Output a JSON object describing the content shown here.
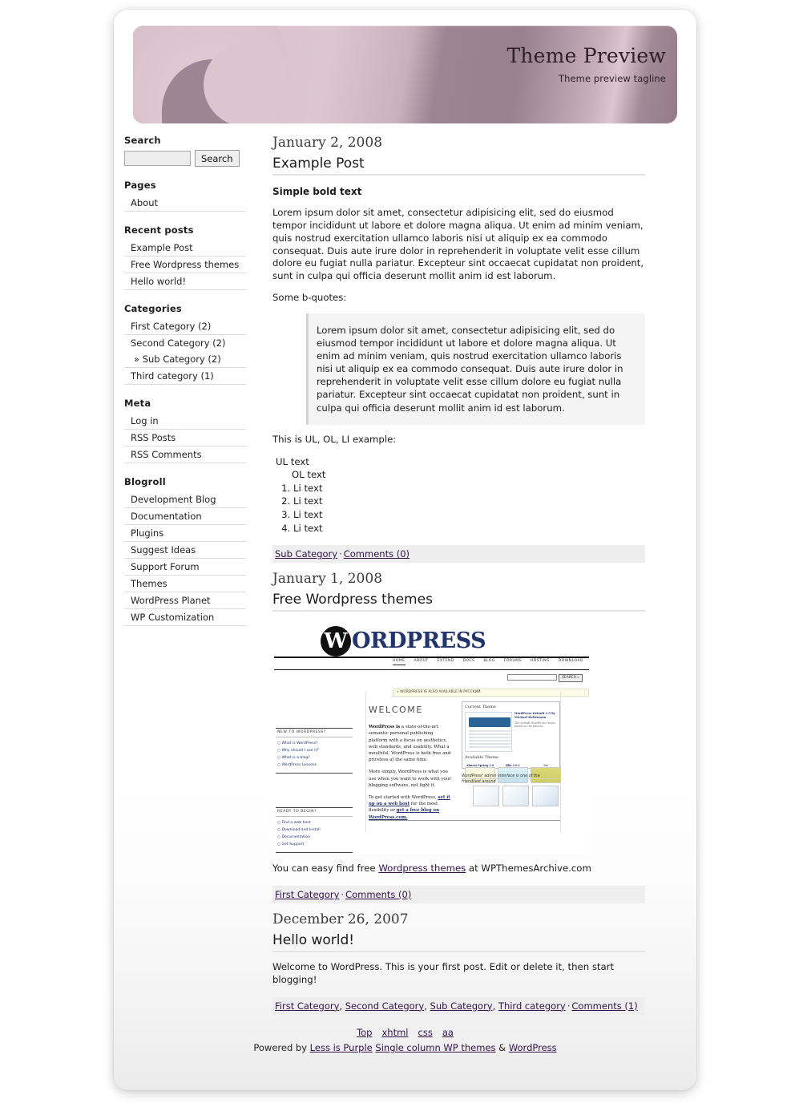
{
  "site": {
    "title": "Theme Preview",
    "tagline": "Theme preview tagline"
  },
  "sidebar": {
    "search": {
      "heading": "Search",
      "value": "",
      "placeholder": "",
      "button_label": "Search"
    },
    "pages": {
      "heading": "Pages",
      "items": [
        {
          "label": "About"
        }
      ]
    },
    "recent_posts": {
      "heading": "Recent posts",
      "items": [
        {
          "label": "Example Post"
        },
        {
          "label": "Free Wordpress themes"
        },
        {
          "label": "Hello world!"
        }
      ]
    },
    "categories": {
      "heading": "Categories",
      "items": [
        {
          "label": "First Category (2)",
          "sub": false
        },
        {
          "label": "Second Category (2)",
          "sub": false
        },
        {
          "label": "» Sub Category (2)",
          "sub": true
        },
        {
          "label": "Third category (1)",
          "sub": false
        }
      ]
    },
    "meta": {
      "heading": "Meta",
      "items": [
        {
          "label": "Log in"
        },
        {
          "label": "RSS Posts"
        },
        {
          "label": "RSS Comments"
        }
      ]
    },
    "blogroll": {
      "heading": "Blogroll",
      "items": [
        {
          "label": "Development Blog"
        },
        {
          "label": "Documentation"
        },
        {
          "label": "Plugins"
        },
        {
          "label": "Suggest Ideas"
        },
        {
          "label": "Support Forum"
        },
        {
          "label": "Themes"
        },
        {
          "label": "WordPress Planet"
        },
        {
          "label": "WP Customization"
        }
      ]
    }
  },
  "posts": [
    {
      "date": "January 2, 2008",
      "title": "Example Post",
      "lead_bold": "Simple bold text",
      "paragraph1": "Lorem ipsum dolor sit amet, consectetur adipisicing elit, sed do eiusmod tempor incididunt ut labore et dolore magna aliqua. Ut enim ad minim veniam, quis nostrud exercitation ullamco laboris nisi ut aliquip ex ea commodo consequat. Duis aute irure dolor in reprehenderit in voluptate velit esse cillum dolore eu fugiat nulla pariatur. Excepteur sint occaecat cupidatat non proident, sunt in culpa qui officia deserunt mollit anim id est laborum.",
      "quote_intro": "Some b-quotes:",
      "blockquote": "Lorem ipsum dolor sit amet, consectetur adipisicing elit, sed do eiusmod tempor incididunt ut labore et dolore magna aliqua. Ut enim ad minim veniam, quis nostrud exercitation ullamco laboris nisi ut aliquip ex ea commodo consequat. Duis aute irure dolor in reprehenderit in voluptate velit esse cillum dolore eu fugiat nulla pariatur. Excepteur sint occaecat cupidatat non proident, sunt in culpa qui officia deserunt mollit anim id est laborum.",
      "list_intro": "This is UL, OL, LI example:",
      "ul_text": "UL text",
      "ol_text": "OL text",
      "li_items": [
        "Li text",
        "Li text",
        "Li text",
        "Li text"
      ],
      "meta": {
        "categories": [
          {
            "label": "Sub Category"
          }
        ],
        "separator": "·",
        "comments": "Comments (0)"
      }
    },
    {
      "date": "January 1, 2008",
      "title": "Free Wordpress themes",
      "caption_before": "You can easy find free ",
      "caption_link": "Wordpress themes",
      "caption_after": " at WPThemesArchive.com",
      "meta": {
        "categories": [
          {
            "label": "First Category"
          }
        ],
        "separator": "·",
        "comments": "Comments (0)"
      }
    },
    {
      "date": "December 26, 2007",
      "title": "Hello world!",
      "paragraph1": "Welcome to WordPress. This is your first post. Edit or delete it, then start blogging!",
      "meta": {
        "categories": [
          {
            "label": "First Category"
          },
          {
            "label": "Second Category"
          },
          {
            "label": "Sub Category"
          },
          {
            "label": "Third category"
          }
        ],
        "separator": "·",
        "comments": "Comments (1)"
      }
    }
  ],
  "wp_screenshot": {
    "wordmark_w": "W",
    "wordmark": "ORD",
    "wordmark2": "P",
    "wordmark3": "RESS",
    "nav": [
      "HOME",
      "ABOUT",
      "EXTEND",
      "DOCS",
      "BLOG",
      "FORUMS",
      "HOSTING",
      "DOWNLOAD"
    ],
    "search_button": "SEARCH »",
    "language_banner": "» WORDPRESS IS ALSO AVAILABLE IN РУССКИЙ.",
    "welcome": "WELCOME",
    "new_heading": "NEW TO WORDPRESS?",
    "new_links": [
      "What is WordPress?",
      "Why should I use it?",
      "What is a blog?",
      "WordPress Lessons"
    ],
    "ready_heading": "READY TO BEGIN?",
    "ready_links": [
      "Find a web host",
      "Download and Install",
      "Documentation",
      "Get Support"
    ],
    "body_bold": "WordPress is",
    "body_p1": " a state-of-the-art semantic personal publishing platform with a focus on aesthetics, web standards, and usability. What a mouthful. WordPress is both free and priceless at the same time.",
    "body_p2": "More simply, WordPress is what you use when you want to work with your blogging software, not fight it.",
    "body_p3_pre": "To get started with WordPress, ",
    "body_p3_link1": "set it up on a web host",
    "body_p3_mid": " for the most flexibility or ",
    "body_p3_link2": "get a free blog on WordPress.com.",
    "current_theme_label": "Current Theme",
    "available_theme_label": "Available Theme",
    "theme_title": "WordPress Default 1.5 by Michael Heilemann",
    "theme_desc": "The default WordPress theme based on the famous.",
    "theme_names": [
      "Almost Spring 1.0",
      "Blix 1.0.1",
      "Cu"
    ],
    "caption": "WordPress' admin interface is one of the friendliest around."
  },
  "footer": {
    "links": [
      {
        "label": "Top"
      },
      {
        "label": "xhtml"
      },
      {
        "label": "css"
      },
      {
        "label": "aa"
      }
    ],
    "powered_prefix": "Powered by ",
    "theme_link": "Less is Purple",
    "theme_link2": "Single column WP themes",
    "amp": " & ",
    "wp_link": "WordPress"
  }
}
